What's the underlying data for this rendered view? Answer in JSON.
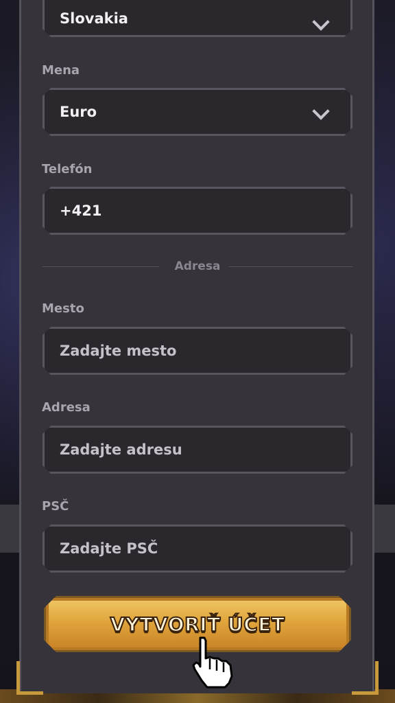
{
  "form": {
    "country": {
      "value": "Slovakia"
    },
    "currency": {
      "label": "Mena",
      "value": "Euro"
    },
    "phone": {
      "label": "Telefón",
      "value": "+421"
    },
    "address_section": {
      "label": "Adresa"
    },
    "city": {
      "label": "Mesto",
      "placeholder": "Zadajte mesto"
    },
    "address": {
      "label": "Adresa",
      "placeholder": "Zadajte adresu"
    },
    "postal": {
      "label": "PSČ",
      "placeholder": "Zadajte PSČ"
    },
    "submit_label": "VYTVORIŤ ÚČET"
  },
  "icons": {
    "select_chevron": "chevron-down-icon",
    "cursor": "hand-pointer-icon"
  },
  "colors": {
    "panel": "#36333b",
    "field": "#2a272d",
    "cta_gold": "#e0a53c",
    "accent_corner": "#c99a3c"
  }
}
